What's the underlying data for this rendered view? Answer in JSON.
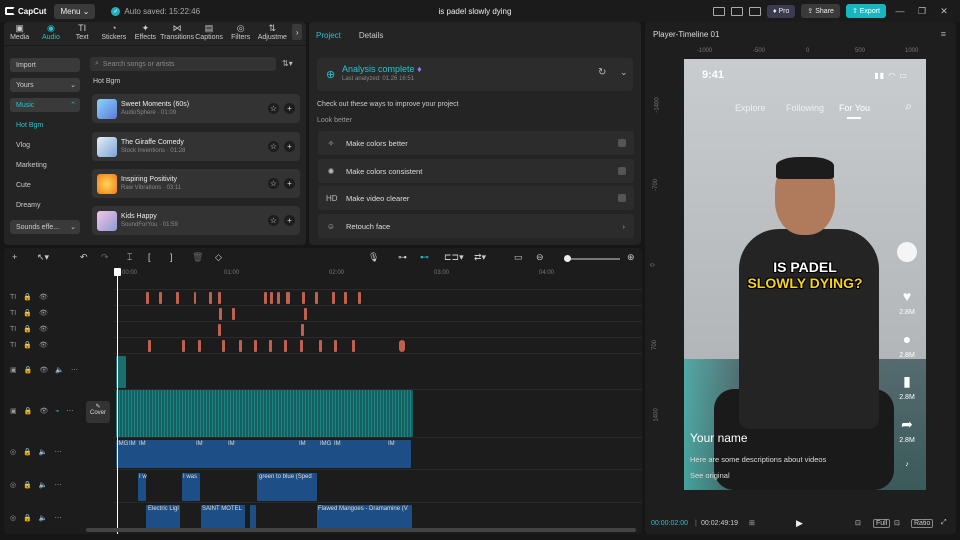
{
  "app": {
    "name": "CapCut",
    "menu_label": "Menu",
    "autosave": "Auto saved: 15:22:46",
    "project_title": "is padel slowly dying",
    "pro_label": "Pro",
    "share_label": "Share",
    "export_label": "Export",
    "accent": "#21c4cf"
  },
  "media": {
    "tools": [
      {
        "label": "Media",
        "icon": "media-icon"
      },
      {
        "label": "Audio",
        "icon": "audio-icon"
      },
      {
        "label": "Text",
        "icon": "text-icon"
      },
      {
        "label": "Stickers",
        "icon": "stickers-icon"
      },
      {
        "label": "Effects",
        "icon": "effects-icon"
      },
      {
        "label": "Transitions",
        "icon": "transitions-icon"
      },
      {
        "label": "Captions",
        "icon": "captions-icon"
      },
      {
        "label": "Filters",
        "icon": "filters-icon"
      },
      {
        "label": "Adjustme",
        "icon": "adjustment-icon"
      }
    ],
    "sidebar": [
      {
        "label": "Import"
      },
      {
        "label": "Yours"
      },
      {
        "label": "Music"
      },
      {
        "label": "Hot Bgm"
      },
      {
        "label": "Vlog"
      },
      {
        "label": "Marketing"
      },
      {
        "label": "Cute"
      },
      {
        "label": "Dreamy"
      },
      {
        "label": "Sounds effe..."
      }
    ],
    "search_placeholder": "Search songs or artists",
    "section": "Hot Bgm",
    "songs": [
      {
        "title": "Sweet Moments (60s)",
        "sub": "AudioSphere · 01:09"
      },
      {
        "title": "The Giraffe Comedy",
        "sub": "Stock Inventions · 01:28"
      },
      {
        "title": "Inspiring Positivity",
        "sub": "Raw Vibrations · 03:11"
      },
      {
        "title": "Kids Happy",
        "sub": "SoundForYou · 01:59"
      }
    ]
  },
  "project": {
    "tabs": [
      "Project",
      "Details"
    ],
    "analysis_title": "Analysis complete",
    "analysis_sub": "Last analyzed: 01.26 16:51",
    "tip": "Check out these ways to improve your project",
    "look_better": "Look better",
    "options": [
      {
        "label": "Make colors better",
        "icon": "magic-wand-icon"
      },
      {
        "label": "Make colors consistent",
        "icon": "palette-icon"
      },
      {
        "label": "Make video clearer",
        "icon": "hd-icon"
      },
      {
        "label": "Retouch face",
        "icon": "face-icon"
      }
    ],
    "hd_text": "HD"
  },
  "player": {
    "title": "Player-Timeline 01",
    "ruler_h": [
      "-1000",
      "-500",
      "0",
      "500",
      "1000"
    ],
    "ruler_v": [
      "-1400",
      "-700",
      "0",
      "700",
      "1400"
    ],
    "video": {
      "time": "9:41",
      "nav": [
        "Explore",
        "Following",
        "For You"
      ],
      "caption_line1": "IS PADEL",
      "caption_line2": "SLOWLY DYING?",
      "likes": "2.8M",
      "comments": "2.8M",
      "saves": "2.8M",
      "shares": "2.8M",
      "name": "Your name",
      "desc": "Here are some descriptions about videos",
      "see_original": "See original"
    },
    "current_time": "00:00:02:00",
    "total_time": "00:02:49:19",
    "full_label": "Full",
    "ratio_label": "Ratio"
  },
  "timeline": {
    "ruler": [
      "00:00",
      "01:00",
      "02:00",
      "03:00",
      "04:00"
    ],
    "cover_label": "Cover",
    "clip_labels": {
      "video": [
        "IMG",
        "IM",
        "IM",
        "IM",
        "IM",
        "IM",
        "IMG",
        "IM",
        "IM"
      ],
      "row7": [
        "I w",
        "I was",
        "green to blue (Sped"
      ],
      "row8": [
        "Electric Ligl",
        "SAINT MOTEL",
        "Flawed Mangoes - Dramamine (V"
      ]
    }
  }
}
